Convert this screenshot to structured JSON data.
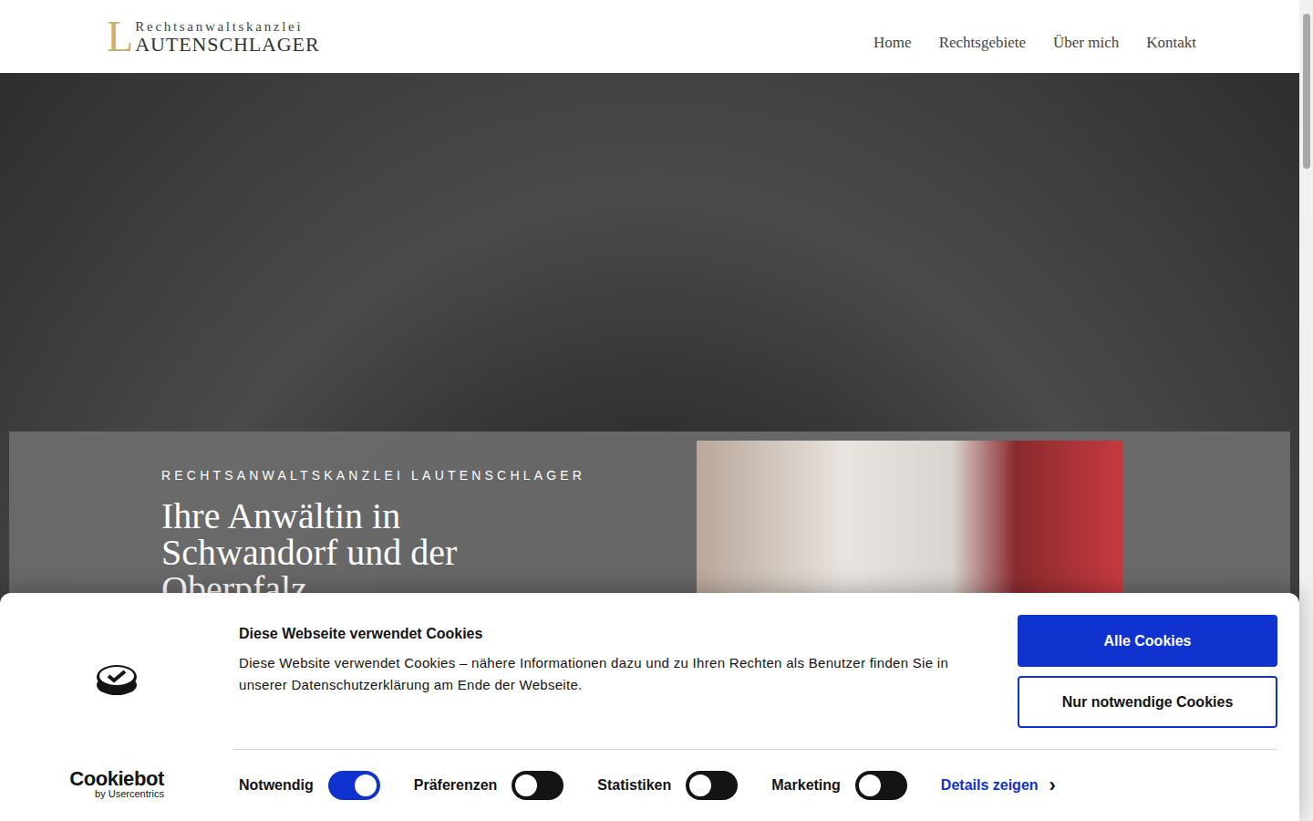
{
  "header": {
    "logo": {
      "initial": "L",
      "top": "Rechtsanwaltskanzlei",
      "bottom": "AUTENSCHLAGER"
    },
    "nav": [
      {
        "label": "Home",
        "selected": false
      },
      {
        "label": "Rechtsgebiete",
        "selected": false
      },
      {
        "label": "Über mich",
        "selected": false
      },
      {
        "label": "Kontakt",
        "selected": false
      }
    ]
  },
  "hero": {
    "eyebrow": "RECHTSANWALTSKANZLEI LAUTENSCHLAGER",
    "heading": "Ihre Anwältin in Schwandorf und der Oberpfalz"
  },
  "cookie_banner": {
    "brand": {
      "name": "Cookiebot",
      "by": "by Usercentrics"
    },
    "title": "Diese Webseite verwendet Cookies",
    "text": "Diese Website verwendet Cookies – nähere Informationen dazu und zu Ihren Rechten als Benutzer finden Sie in unserer Datenschutzerklärung am Ende der Webseite.",
    "buttons": [
      {
        "label": "Alle Cookies",
        "kind": "primary"
      },
      {
        "label": "Nur notwendige Cookies",
        "kind": "outline"
      }
    ],
    "toggles": [
      {
        "label": "Notwendig",
        "on": true
      },
      {
        "label": "Präferenzen",
        "on": false
      },
      {
        "label": "Statistiken",
        "on": false
      },
      {
        "label": "Marketing",
        "on": false
      }
    ],
    "details": {
      "label": "Details zeigen",
      "icon": "›"
    }
  }
}
